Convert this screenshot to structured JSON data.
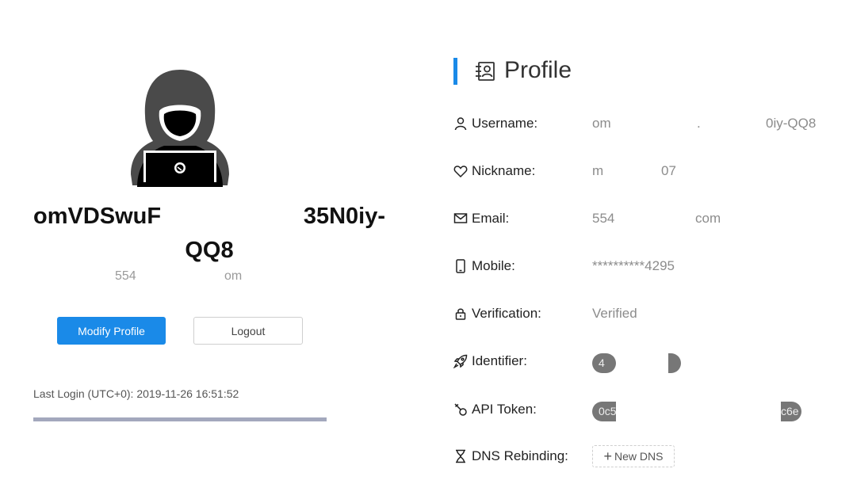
{
  "profile_card": {
    "username_part1": "omVDSwuF",
    "username_part2": "35N0iy-",
    "username_part3": "QQ8",
    "email_part1": "554",
    "email_part2": "om",
    "modify_label": "Modify Profile",
    "logout_label": "Logout",
    "last_login": "Last Login (UTC+0): 2019-11-26 16:51:52",
    "progress_fraction": 1
  },
  "section": {
    "title": "Profile"
  },
  "fields": {
    "username": {
      "label": "Username:",
      "value_part1": "om",
      "value_part2": ".",
      "value_part3": "0iy-QQ8"
    },
    "nickname": {
      "label": "Nickname:",
      "value_part1": "m",
      "value_part2": "07"
    },
    "email": {
      "label": "Email:",
      "value_part1": "554",
      "value_part2": "com"
    },
    "mobile": {
      "label": "Mobile:",
      "value": "**********4295"
    },
    "verification": {
      "label": "Verification:",
      "value": "Verified"
    },
    "identifier": {
      "label": "Identifier:",
      "value_part1": "4"
    },
    "api_token": {
      "label": "API Token:",
      "value_part1": "0c5",
      "value_part2": "c6e"
    },
    "dns_rebinding": {
      "label": "DNS Rebinding:",
      "button_label": "New DNS"
    }
  },
  "colors": {
    "accent": "#1a8ae8",
    "muted_text": "#8c8c8c",
    "pill": "#777777"
  },
  "icons": {
    "avatar": "hacker-avatar-icon",
    "section": "contact-card-icon",
    "username": "user-icon",
    "nickname": "heart-icon",
    "email": "envelope-icon",
    "mobile": "mobile-phone-icon",
    "verification": "lock-icon",
    "identifier": "rocket-icon",
    "api_token": "key-icon",
    "dns_rebinding": "hourglass-icon"
  }
}
